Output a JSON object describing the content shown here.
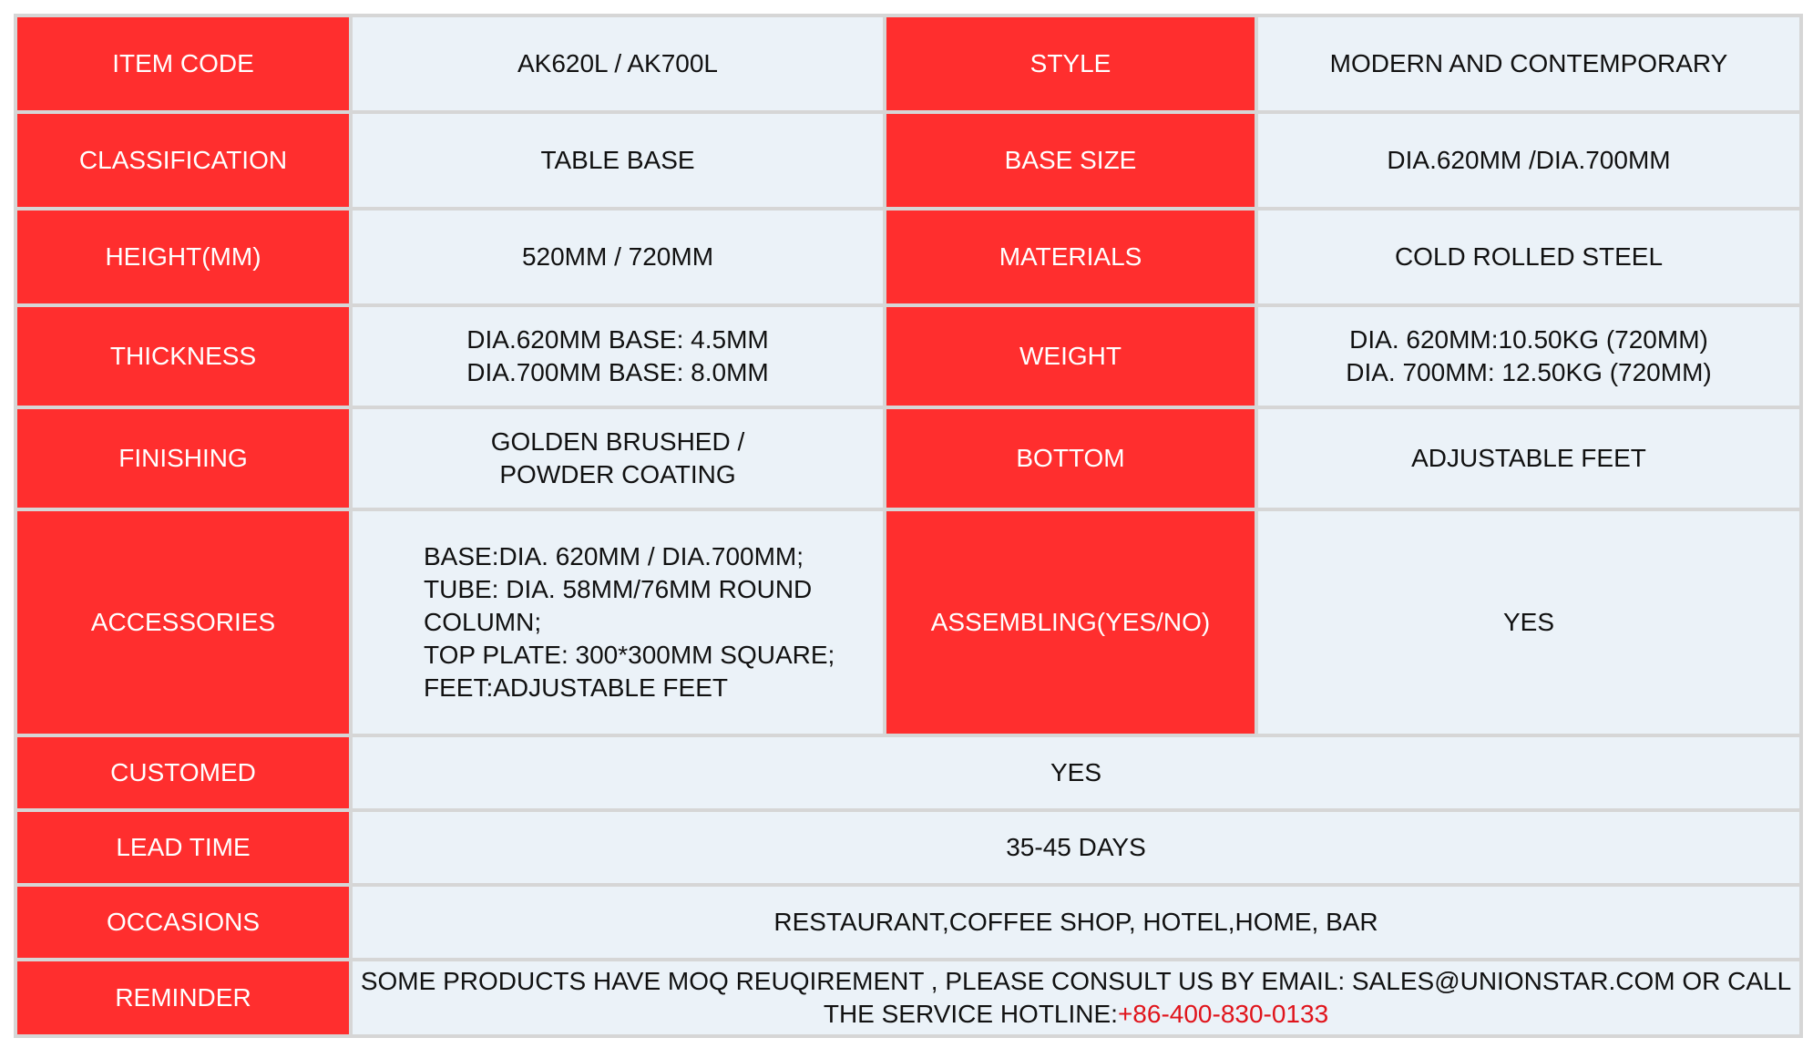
{
  "accent_color": "#ff2e2e",
  "value_background": "#ebf2f8",
  "hotline_color": "#e0141b",
  "rows": {
    "item_code": {
      "label": "ITEM CODE",
      "value": "AK620L / AK700L"
    },
    "style": {
      "label": "STYLE",
      "value": "MODERN AND CONTEMPORARY"
    },
    "classification": {
      "label": "CLASSIFICATION",
      "value": "TABLE BASE"
    },
    "base_size": {
      "label": "BASE SIZE",
      "value": "DIA.620MM /DIA.700MM"
    },
    "height": {
      "label": "HEIGHT(MM)",
      "value": "520MM / 720MM"
    },
    "materials": {
      "label": "MATERIALS",
      "value": "COLD ROLLED STEEL"
    },
    "thickness": {
      "label": "THICKNESS",
      "lines": [
        "DIA.620MM BASE: 4.5MM",
        "DIA.700MM BASE: 8.0MM"
      ]
    },
    "weight": {
      "label": "WEIGHT",
      "lines": [
        "DIA. 620MM:10.50KG (720MM)",
        "DIA. 700MM: 12.50KG (720MM)"
      ]
    },
    "finishing": {
      "label": "FINISHING",
      "lines": [
        "GOLDEN BRUSHED /",
        "POWDER COATING"
      ]
    },
    "bottom": {
      "label": "BOTTOM",
      "value": "ADJUSTABLE FEET"
    },
    "accessories": {
      "label": "ACCESSORIES",
      "lines": [
        "BASE:DIA. 620MM / DIA.700MM;",
        "TUBE: DIA. 58MM/76MM ROUND",
        "COLUMN;",
        "TOP PLATE: 300*300MM SQUARE;",
        "FEET:ADJUSTABLE FEET"
      ]
    },
    "assembling": {
      "label": "ASSEMBLING(YES/NO)",
      "value": "YES"
    },
    "customed": {
      "label": "CUSTOMED",
      "value": "YES"
    },
    "lead_time": {
      "label": "LEAD TIME",
      "value": "35-45 DAYS"
    },
    "occasions": {
      "label": "OCCASIONS",
      "value": "RESTAURANT,COFFEE SHOP, HOTEL,HOME, BAR"
    },
    "reminder": {
      "label": "REMINDER",
      "line1": "SOME PRODUCTS HAVE MOQ REUQIREMENT , PLEASE CONSULT US BY EMAIL: SALES@UNIONSTAR.COM OR CALL",
      "line2_prefix": "THE SERVICE HOTLINE:",
      "hotline": "+86-400-830-0133"
    }
  }
}
